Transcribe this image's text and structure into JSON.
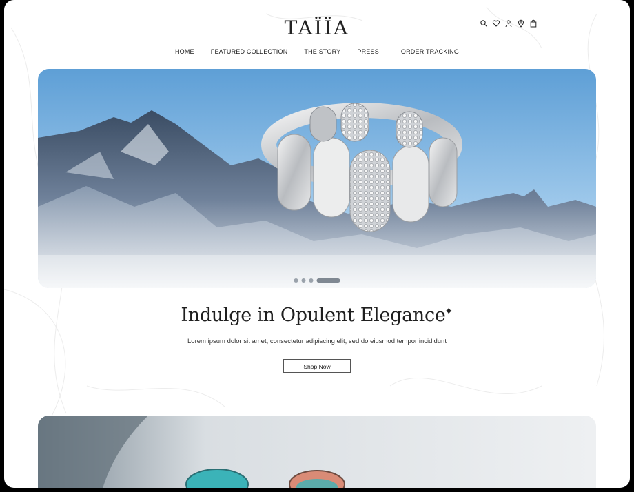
{
  "brand": {
    "logo": "TAÏÏA"
  },
  "header_icons": [
    "search-icon",
    "heart-icon",
    "user-icon",
    "location-icon",
    "bag-icon"
  ],
  "nav": {
    "items": [
      "HOME",
      "FEATURED COLLECTION",
      "THE STORY",
      "PRESS",
      "ORDER TRACKING"
    ]
  },
  "hero": {
    "slides_count": 4,
    "active_slide": 4
  },
  "headline": {
    "title": "Indulge in Opulent Elegance",
    "sparkle": "✦",
    "subtitle": "Lorem ipsum dolor sit amet, consectetur adipiscing elit, sed do eiusmod tempor incididunt",
    "cta": "Shop Now"
  },
  "colors": {
    "text": "#222222",
    "sky": "#6fa8d8",
    "page_bg": "#ffffff"
  }
}
